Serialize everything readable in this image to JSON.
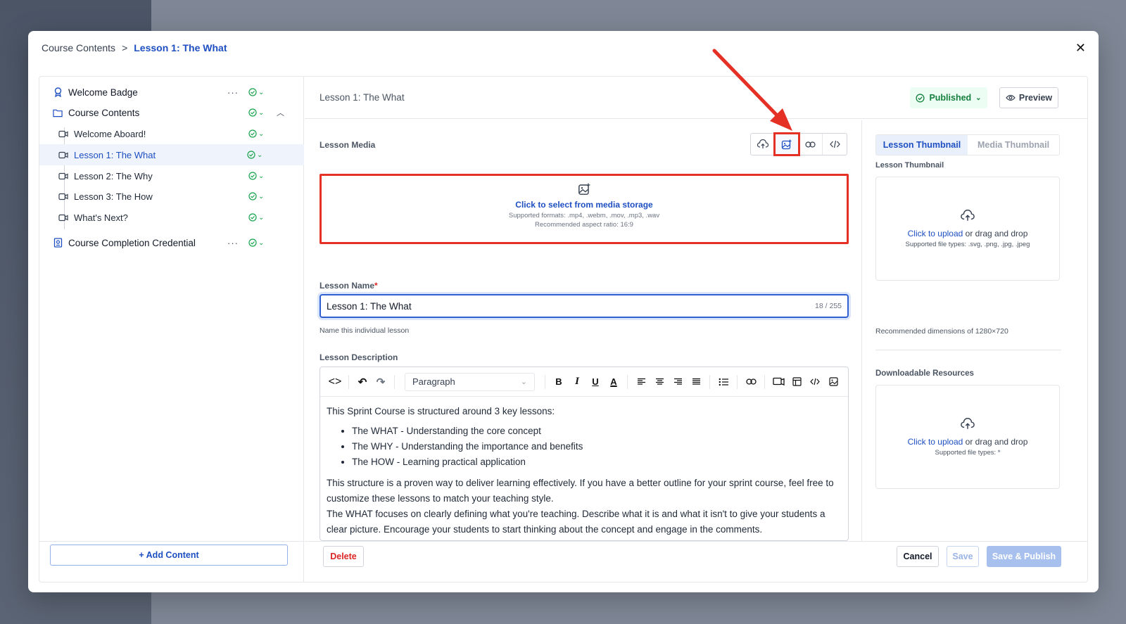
{
  "breadcrumb": {
    "parent": "Course Contents",
    "separator": ">",
    "current": "Lesson 1: The What"
  },
  "sidebar": {
    "items": [
      {
        "label": "Welcome Badge",
        "icon": "badge-icon",
        "level": 0,
        "has_menu": true
      },
      {
        "label": "Course Contents",
        "icon": "folder-icon",
        "level": 0,
        "expanded": true
      },
      {
        "label": "Welcome Aboard!",
        "icon": "video-icon",
        "level": 1
      },
      {
        "label": "Lesson 1: The What",
        "icon": "video-icon",
        "level": 1,
        "selected": true
      },
      {
        "label": "Lesson 2: The Why",
        "icon": "video-icon",
        "level": 1
      },
      {
        "label": "Lesson 3: The How",
        "icon": "video-icon",
        "level": 1
      },
      {
        "label": "What's Next?",
        "icon": "video-icon",
        "level": 1
      },
      {
        "label": "Course Completion Credential",
        "icon": "credential-icon",
        "level": 0,
        "has_menu": true
      }
    ],
    "menu_glyph": "···",
    "add_content": "+ Add Content"
  },
  "header": {
    "title": "Lesson 1: The What",
    "status": "Published",
    "preview": "Preview"
  },
  "media": {
    "label": "Lesson Media",
    "tools": [
      "upload-icon",
      "media-storage-icon",
      "link-icon",
      "embed-code-icon"
    ],
    "dropzone_link": "Click to select from media storage",
    "dropzone_formats": "Supported formats: .mp4, .webm, .mov, .mp3, .wav",
    "dropzone_ratio": "Recommended aspect ratio: 16:9"
  },
  "lesson_name": {
    "label": "Lesson Name",
    "required": "*",
    "value": "Lesson 1: The What",
    "count": "18 / 255",
    "help": "Name this individual lesson"
  },
  "description": {
    "label": "Lesson Description",
    "block_style": "Paragraph",
    "intro": "This Sprint Course is structured around 3 key lessons:",
    "bullets": [
      "The WHAT - Understanding the core concept",
      "The WHY - Understanding the importance and benefits",
      "The HOW - Learning practical application"
    ],
    "para1": "This structure is a proven way to deliver learning effectively. If you have a better outline for your sprint course, feel free to customize these lessons to match your teaching style.",
    "para2": "The WHAT focuses on clearly defining what you're teaching. Describe what it is and what it isn't to give your students a clear picture. Encourage your students to start thinking about the concept and engage in the comments."
  },
  "right_panel": {
    "tabs": [
      "Lesson Thumbnail",
      "Media Thumbnail"
    ],
    "thumb_label": "Lesson Thumbnail",
    "upload_link": "Click to upload",
    "upload_rest": " or drag and drop",
    "thumb_types": "Supported file types: .svg, .png, .jpg, .jpeg",
    "thumb_note": "Recommended dimensions of 1280×720",
    "resources_label": "Downloadable Resources",
    "resources_types": "Supported file types: *"
  },
  "footer": {
    "delete": "Delete",
    "cancel": "Cancel",
    "save": "Save",
    "save_publish": "Save & Publish"
  },
  "colors": {
    "accent": "#1e4fc2",
    "published": "#15803d",
    "highlight": "#e53025",
    "danger": "#dc2626"
  }
}
